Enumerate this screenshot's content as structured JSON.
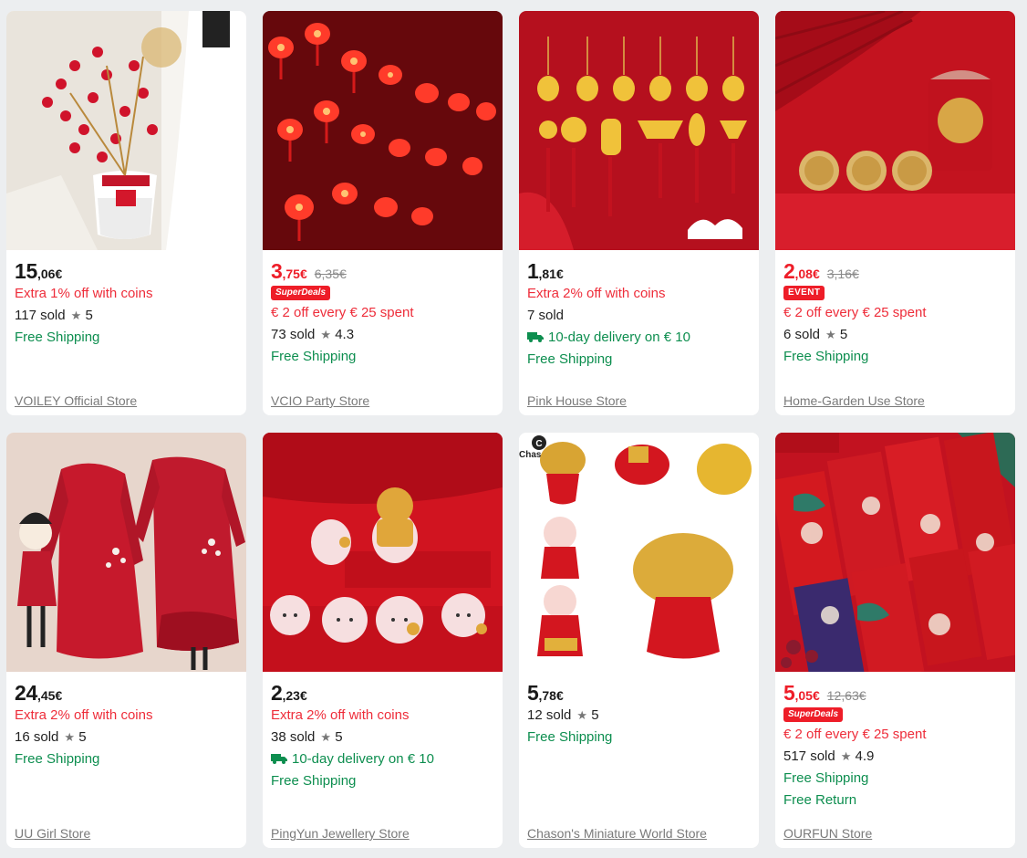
{
  "products": [
    {
      "price_int": "15",
      "price_dec": ",06€",
      "old_price": "",
      "price_color": "black",
      "badge": "",
      "lines": [
        {
          "text": "Extra 1% off with coins",
          "kind": "red"
        },
        {
          "text": "117 sold",
          "kind": "sold",
          "rating": "5"
        },
        {
          "text": "Free Shipping",
          "kind": "green"
        }
      ],
      "store": "VOILEY Official Store",
      "image": "vase-flowers"
    },
    {
      "price_int": "3",
      "price_dec": ",75€",
      "old_price": "6,35€",
      "price_color": "red",
      "badge": "SuperDeals",
      "lines": [
        {
          "text": "€ 2 off every € 25 spent",
          "kind": "red"
        },
        {
          "text": "73 sold",
          "kind": "sold",
          "rating": "4.3"
        },
        {
          "text": "Free Shipping",
          "kind": "green"
        }
      ],
      "store": "VCIO Party Store",
      "image": "lantern-lights"
    },
    {
      "price_int": "1",
      "price_dec": ",81€",
      "old_price": "",
      "price_color": "black",
      "badge": "",
      "lines": [
        {
          "text": "Extra 2% off with coins",
          "kind": "red"
        },
        {
          "text": "7 sold",
          "kind": "sold",
          "rating": ""
        },
        {
          "text": "10-day delivery on € 10",
          "kind": "delivery"
        },
        {
          "text": "Free Shipping",
          "kind": "green"
        }
      ],
      "store": "Pink House Store",
      "image": "gold-pendants"
    },
    {
      "price_int": "2",
      "price_dec": ",08€",
      "old_price": "3,16€",
      "price_color": "red",
      "badge": "EVENT",
      "lines": [
        {
          "text": "€ 2 off every € 25 spent",
          "kind": "red"
        },
        {
          "text": "6 sold",
          "kind": "sold",
          "rating": "5"
        },
        {
          "text": "Free Shipping",
          "kind": "green"
        }
      ],
      "store": "Home-Garden Use Store",
      "image": "gold-coins"
    },
    {
      "price_int": "24",
      "price_dec": ",45€",
      "old_price": "",
      "price_color": "black",
      "badge": "",
      "lines": [
        {
          "text": "Extra 2% off with coins",
          "kind": "red"
        },
        {
          "text": "16 sold",
          "kind": "sold",
          "rating": "5"
        },
        {
          "text": "Free Shipping",
          "kind": "green"
        }
      ],
      "store": "UU Girl Store",
      "image": "red-dress"
    },
    {
      "price_int": "2",
      "price_dec": ",23€",
      "old_price": "",
      "price_color": "black",
      "badge": "",
      "lines": [
        {
          "text": "Extra 2% off with coins",
          "kind": "red"
        },
        {
          "text": "38 sold",
          "kind": "sold",
          "rating": "5"
        },
        {
          "text": "10-day delivery on € 10",
          "kind": "delivery"
        },
        {
          "text": "Free Shipping",
          "kind": "green"
        }
      ],
      "store": "PingYun Jewellery Store",
      "image": "rabbit-figurines"
    },
    {
      "price_int": "5",
      "price_dec": ",78€",
      "old_price": "",
      "price_color": "black",
      "badge": "",
      "lines": [
        {
          "text": "12 sold",
          "kind": "sold",
          "rating": "5"
        },
        {
          "text": "Free Shipping",
          "kind": "green"
        }
      ],
      "store": "Chason's Miniature World Store",
      "image": "money-tree",
      "image_caption": "Chason's"
    },
    {
      "price_int": "5",
      "price_dec": ",05€",
      "old_price": "12,63€",
      "price_color": "red",
      "badge": "SuperDeals",
      "lines": [
        {
          "text": "€ 2 off every € 25 spent",
          "kind": "red"
        },
        {
          "text": "517 sold",
          "kind": "sold",
          "rating": "4.9"
        },
        {
          "text": "Free Shipping",
          "kind": "green"
        },
        {
          "text": "Free Return",
          "kind": "green"
        }
      ],
      "store": "OURFUN Store",
      "image": "red-envelopes"
    }
  ]
}
